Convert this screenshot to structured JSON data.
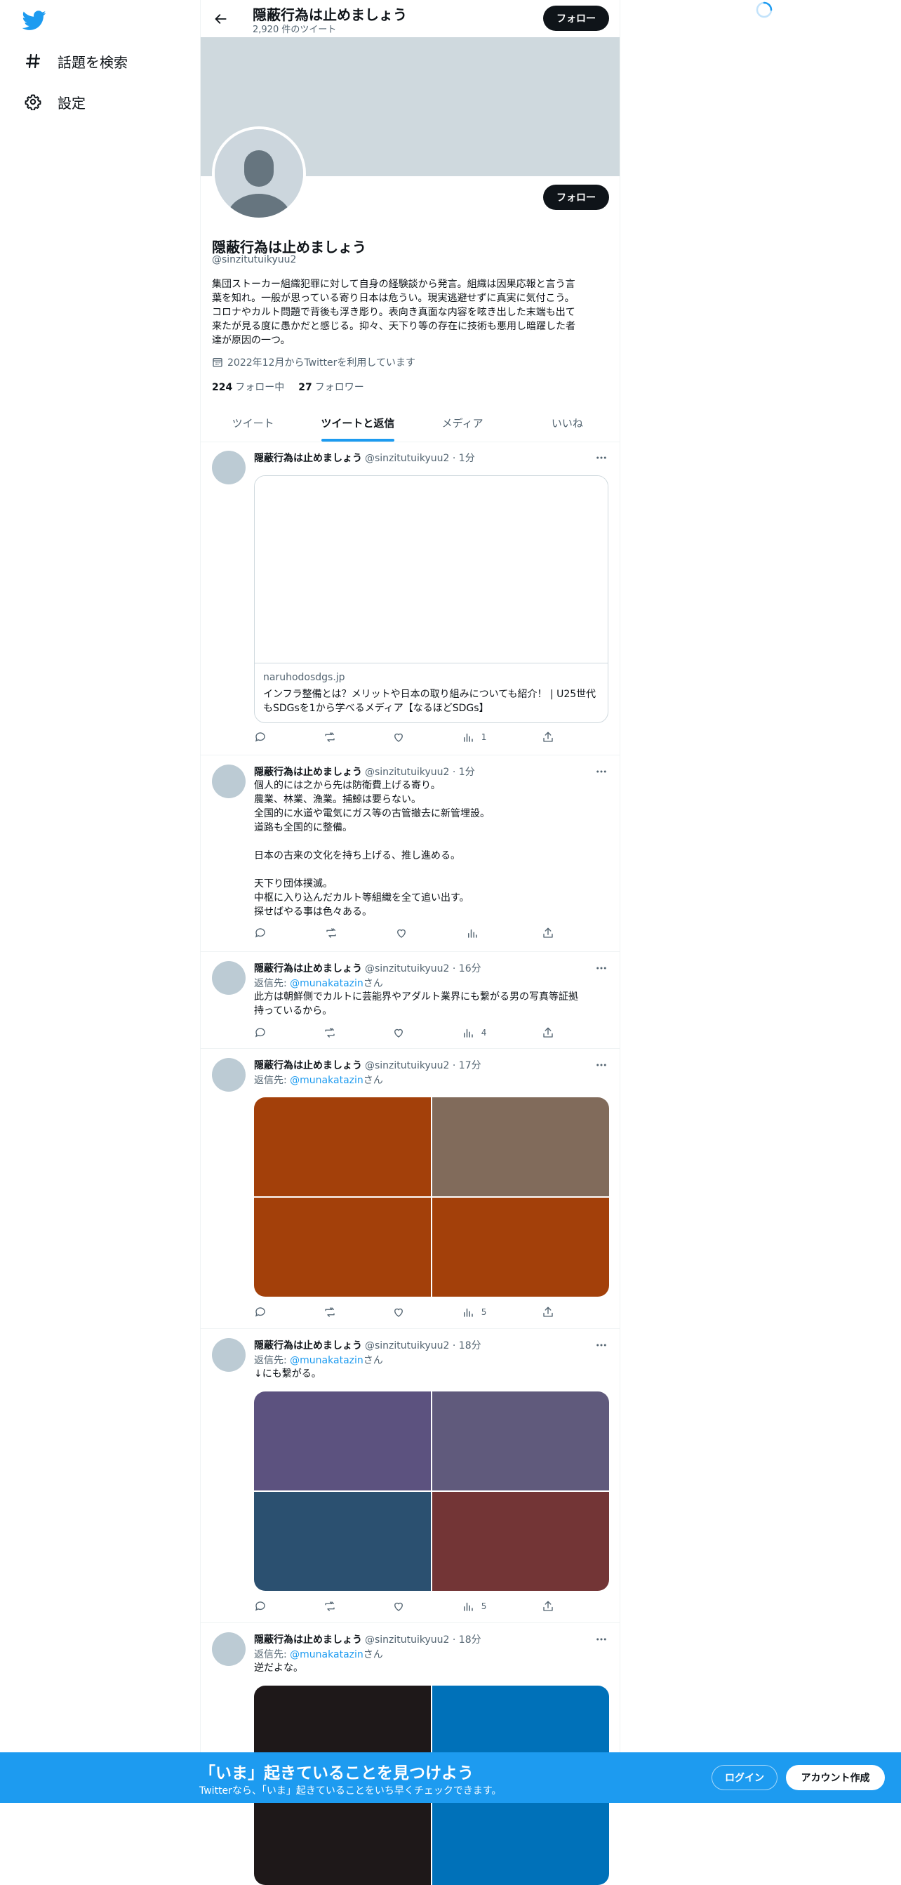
{
  "nav": {
    "logo_icon": "twitter-bird-icon",
    "items": [
      {
        "label": "話題を検索",
        "icon": "hashtag-icon"
      },
      {
        "label": "設定",
        "icon": "gear-icon"
      }
    ]
  },
  "header": {
    "title": "隠蔽行為は止めましょう",
    "tweet_count": "2,920 件のツイート",
    "follow_label": "フォロー"
  },
  "profile": {
    "name": "隠蔽行為は止めましょう",
    "handle": "@sinzitutuikyuu2",
    "bio": "集団ストーカー組織犯罪に対して自身の経験談から発言。組織は因果応報と言う言\n葉を知れ。一般が思っている寄り日本は危うい。現実逃避せずに真実に気付こう。\nコロナやカルト問題で背後も浮き彫り。表向き真面な内容を呟き出した末端も出て\n来たが見る度に愚かだと感じる。抑々、天下り等の存在に技術も悪用し暗躍した者\n達が原因の一つ。",
    "joined": "2022年12月からTwitterを利用しています",
    "following_count": "224",
    "following_label": "フォロー中",
    "followers_count": "27",
    "followers_label": "フォロワー",
    "follow_label": "フォロー"
  },
  "tabs": [
    {
      "label": "ツイート",
      "active": false
    },
    {
      "label": "ツイートと返信",
      "active": true
    },
    {
      "label": "メディア",
      "active": false
    },
    {
      "label": "いいね",
      "active": false
    }
  ],
  "tweets": [
    {
      "name": "隠蔽行為は止めましょう",
      "meta": "@sinzitutuikyuu2 · 1分",
      "card": {
        "domain": "naruhodosdgs.jp",
        "title": "インフラ整備とは？メリットや日本の取り組みについても紹介！ | U25世代もSDGsを1から学べるメディア【なるほどSDGs】"
      },
      "views": "1"
    },
    {
      "name": "隠蔽行為は止めましょう",
      "meta": "@sinzitutuikyuu2 · 1分",
      "text": "個人的には之から先は防衛費上げる寄り。\n農業、林業、漁業。捕鯨は要らない。\n全国的に水道や電気にガス等の古管撤去に新管埋設。\n道路も全国的に整備。\n\n日本の古来の文化を持ち上げる、推し進める。\n\n天下り団体撲滅。\n中枢に入り込んだカルト等組織を全て追い出す。\n探せばやる事は色々ある。",
      "views": ""
    },
    {
      "name": "隠蔽行為は止めましょう",
      "meta": "@sinzitutuikyuu2 · 16分",
      "reply_prefix": "返信先: ",
      "reply_to": "@munakatazin",
      "reply_suffix": "さん",
      "text": "此方は朝鮮側でカルトに芸能界やアダルト業界にも繋がる男の写真等証拠\n持っているから。",
      "views": "4"
    },
    {
      "name": "隠蔽行為は止めましょう",
      "meta": "@sinzitutuikyuu2 · 17分",
      "reply_prefix": "返信先: ",
      "reply_to": "@munakatazin",
      "reply_suffix": "さん",
      "images": [
        "#a3400a",
        "#816b5b",
        "#a3400a",
        "#a3400a"
      ],
      "views": "5"
    },
    {
      "name": "隠蔽行為は止めましょう",
      "meta": "@sinzitutuikyuu2 · 18分",
      "reply_prefix": "返信先: ",
      "reply_to": "@munakatazin",
      "reply_suffix": "さん",
      "text": "↓にも繋がる。",
      "images": [
        "#5c527f",
        "#605a7c",
        "#2b5070",
        "#733536"
      ],
      "views": "5"
    },
    {
      "name": "隠蔽行為は止めましょう",
      "meta": "@sinzitutuikyuu2 · 18分",
      "reply_prefix": "返信先: ",
      "reply_to": "@munakatazin",
      "reply_suffix": "さん",
      "text": "逆だよな。",
      "images": [
        "#1e1819",
        "#0071b9"
      ]
    }
  ],
  "bottom_bar": {
    "title": "「いま」起きていることを見つけよう",
    "subtitle": "Twitterなら、「いま」起きていることをいち早くチェックできます。",
    "login_label": "ログイン",
    "signup_label": "アカウント作成"
  },
  "colors": {
    "accent": "#1d9bf0",
    "banner": "#cfd9de",
    "text": "#0f1419",
    "muted": "#536471"
  }
}
